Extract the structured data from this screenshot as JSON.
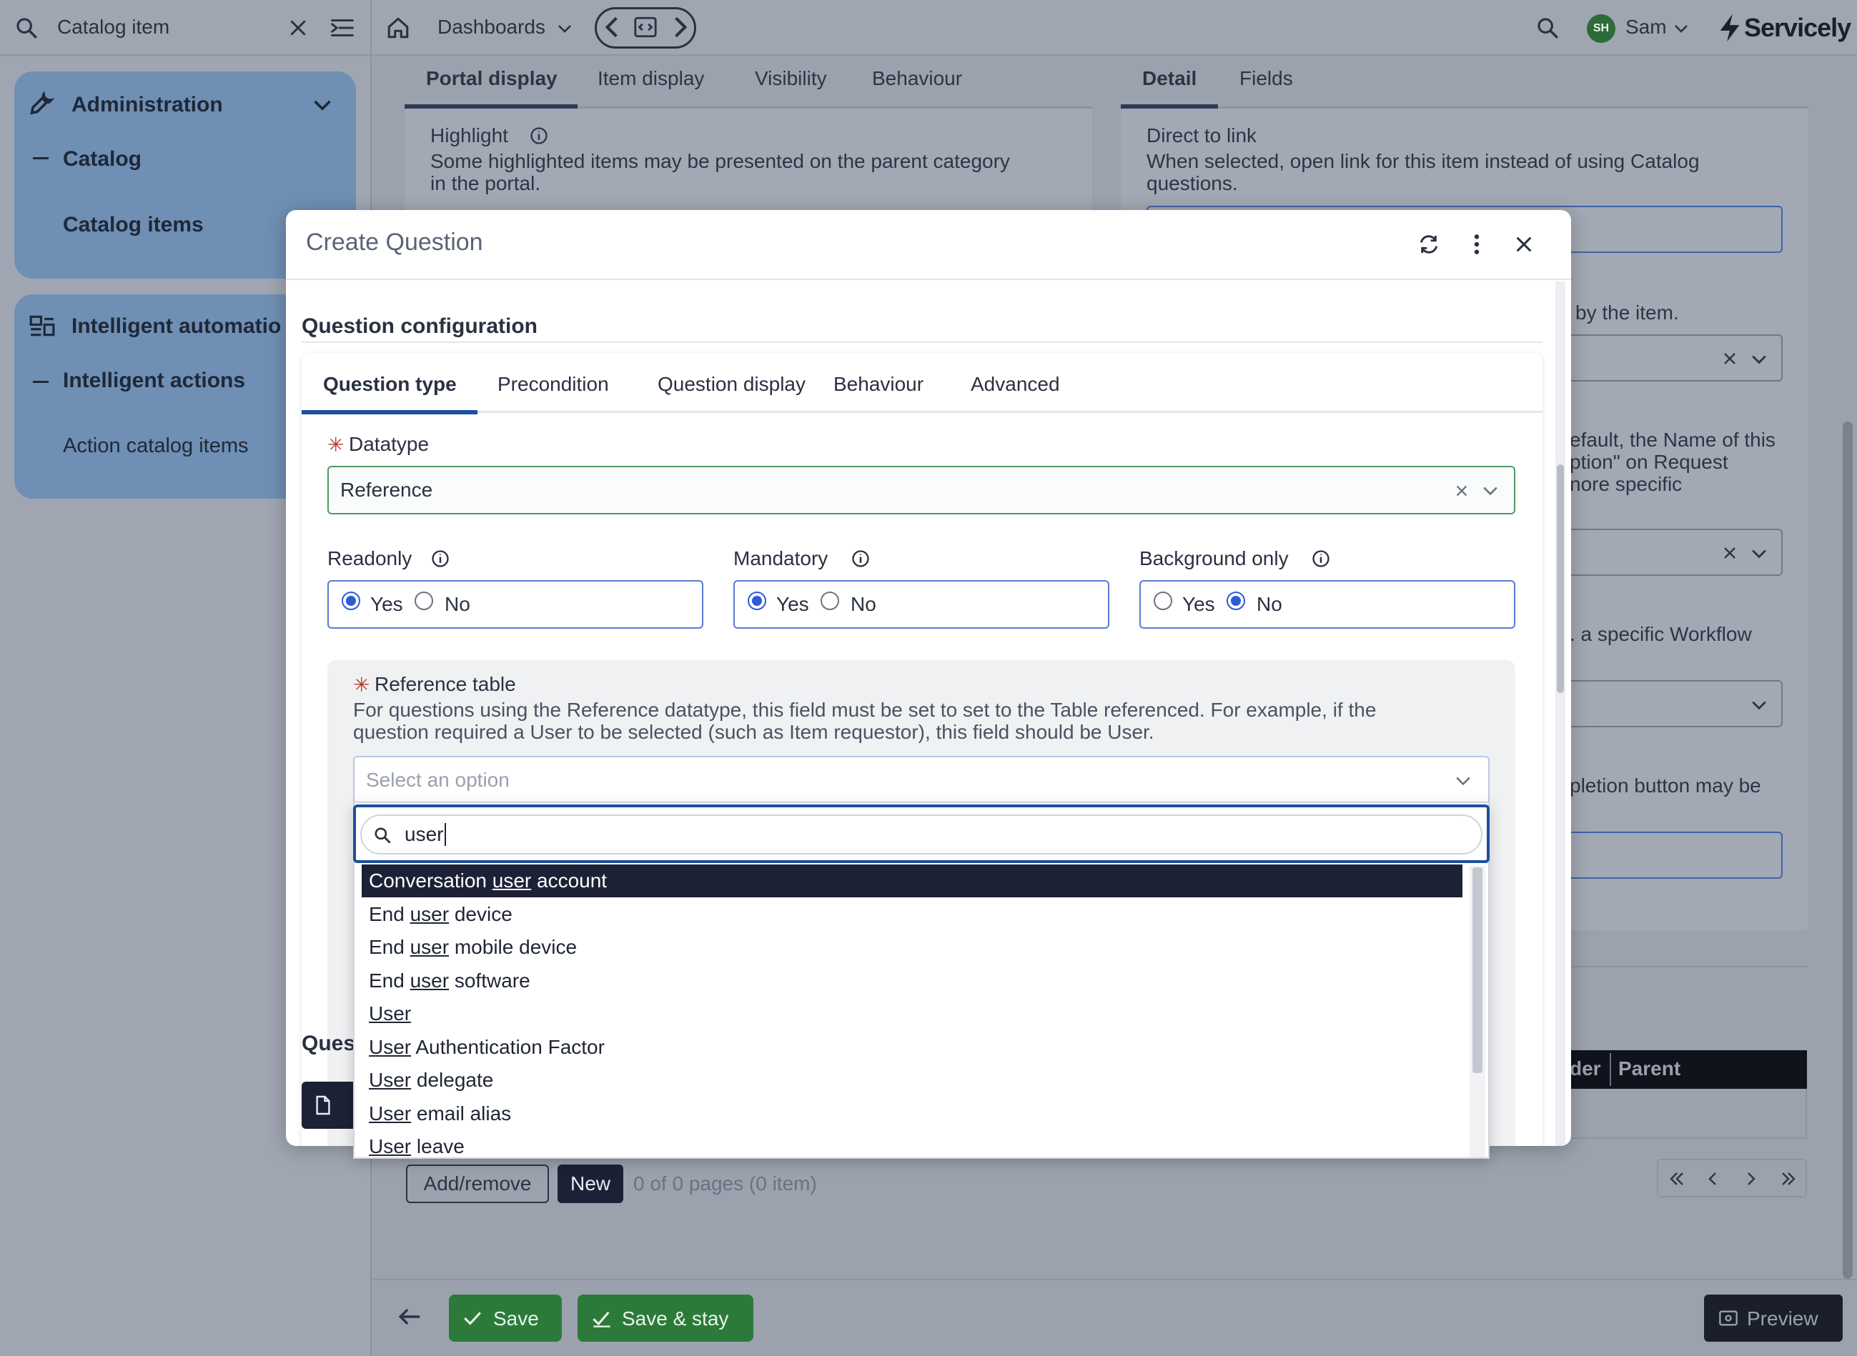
{
  "topbar": {
    "search_value": "Catalog item",
    "dashboards_label": "Dashboards",
    "user_initials": "SH",
    "user_name": "Sam",
    "brand": "Servicely"
  },
  "sidebar": {
    "administration": "Administration",
    "catalog": "Catalog",
    "catalog_items": "Catalog items",
    "intelligent_automation": "Intelligent automatio",
    "intelligent_actions": "Intelligent actions",
    "action_catalog_items": "Action catalog items"
  },
  "background": {
    "tabs_left": [
      "Portal display",
      "Item display",
      "Visibility",
      "Behaviour"
    ],
    "tabs_right": [
      "Detail",
      "Fields"
    ],
    "highlight_label": "Highlight",
    "highlight_desc_1": "Some highlighted items may be presented on the parent category",
    "highlight_desc_2": "in the portal.",
    "direct_link_label": "Direct to link",
    "direct_link_desc_1": "When selected, open link for this item instead of using Catalog",
    "direct_link_desc_2": "questions.",
    "frag_by_item": "by the item.",
    "frag_default_1": "efault, the Name of this",
    "frag_default_2": "ption\" on Request",
    "frag_default_3": "nore specific",
    "frag_workflow": ". a specific Workflow",
    "frag_completion": "pletion button may be",
    "table_headers": [
      "der",
      "Parent"
    ],
    "add_remove": "Add/remove",
    "new": "New",
    "pager_text": "0 of 0 pages (0 item)",
    "save": "Save",
    "save_stay": "Save & stay",
    "preview": "Preview",
    "ques_fragment": "Ques"
  },
  "dialog": {
    "title": "Create Question",
    "section_title": "Question configuration",
    "tabs": [
      "Question type",
      "Precondition",
      "Question display",
      "Behaviour",
      "Advanced"
    ],
    "datatype_label": "Datatype",
    "datatype_value": "Reference",
    "readonly_label": "Readonly",
    "mandatory_label": "Mandatory",
    "background_only_label": "Background only",
    "yes": "Yes",
    "no": "No",
    "reference_table_label": "Reference table",
    "reference_table_desc_1": "For questions using the Reference datatype, this field must be set to set to the Table referenced. For example, if the",
    "reference_table_desc_2": "question required a User to be selected (such as Item requestor), this field should be User.",
    "select_placeholder": "Select an option",
    "search_value": "user"
  },
  "options": [
    {
      "pre": "Conversation ",
      "match": "user",
      "post": " account"
    },
    {
      "pre": "End ",
      "match": "user",
      "post": " device"
    },
    {
      "pre": "End ",
      "match": "user",
      "post": " mobile device"
    },
    {
      "pre": "End ",
      "match": "user",
      "post": " software"
    },
    {
      "pre": "",
      "match": "User",
      "post": ""
    },
    {
      "pre": "",
      "match": "User",
      "post": " Authentication Factor"
    },
    {
      "pre": "",
      "match": "User",
      "post": " delegate"
    },
    {
      "pre": "",
      "match": "User",
      "post": " email alias"
    },
    {
      "pre": "",
      "match": "User",
      "post": " leave"
    }
  ]
}
